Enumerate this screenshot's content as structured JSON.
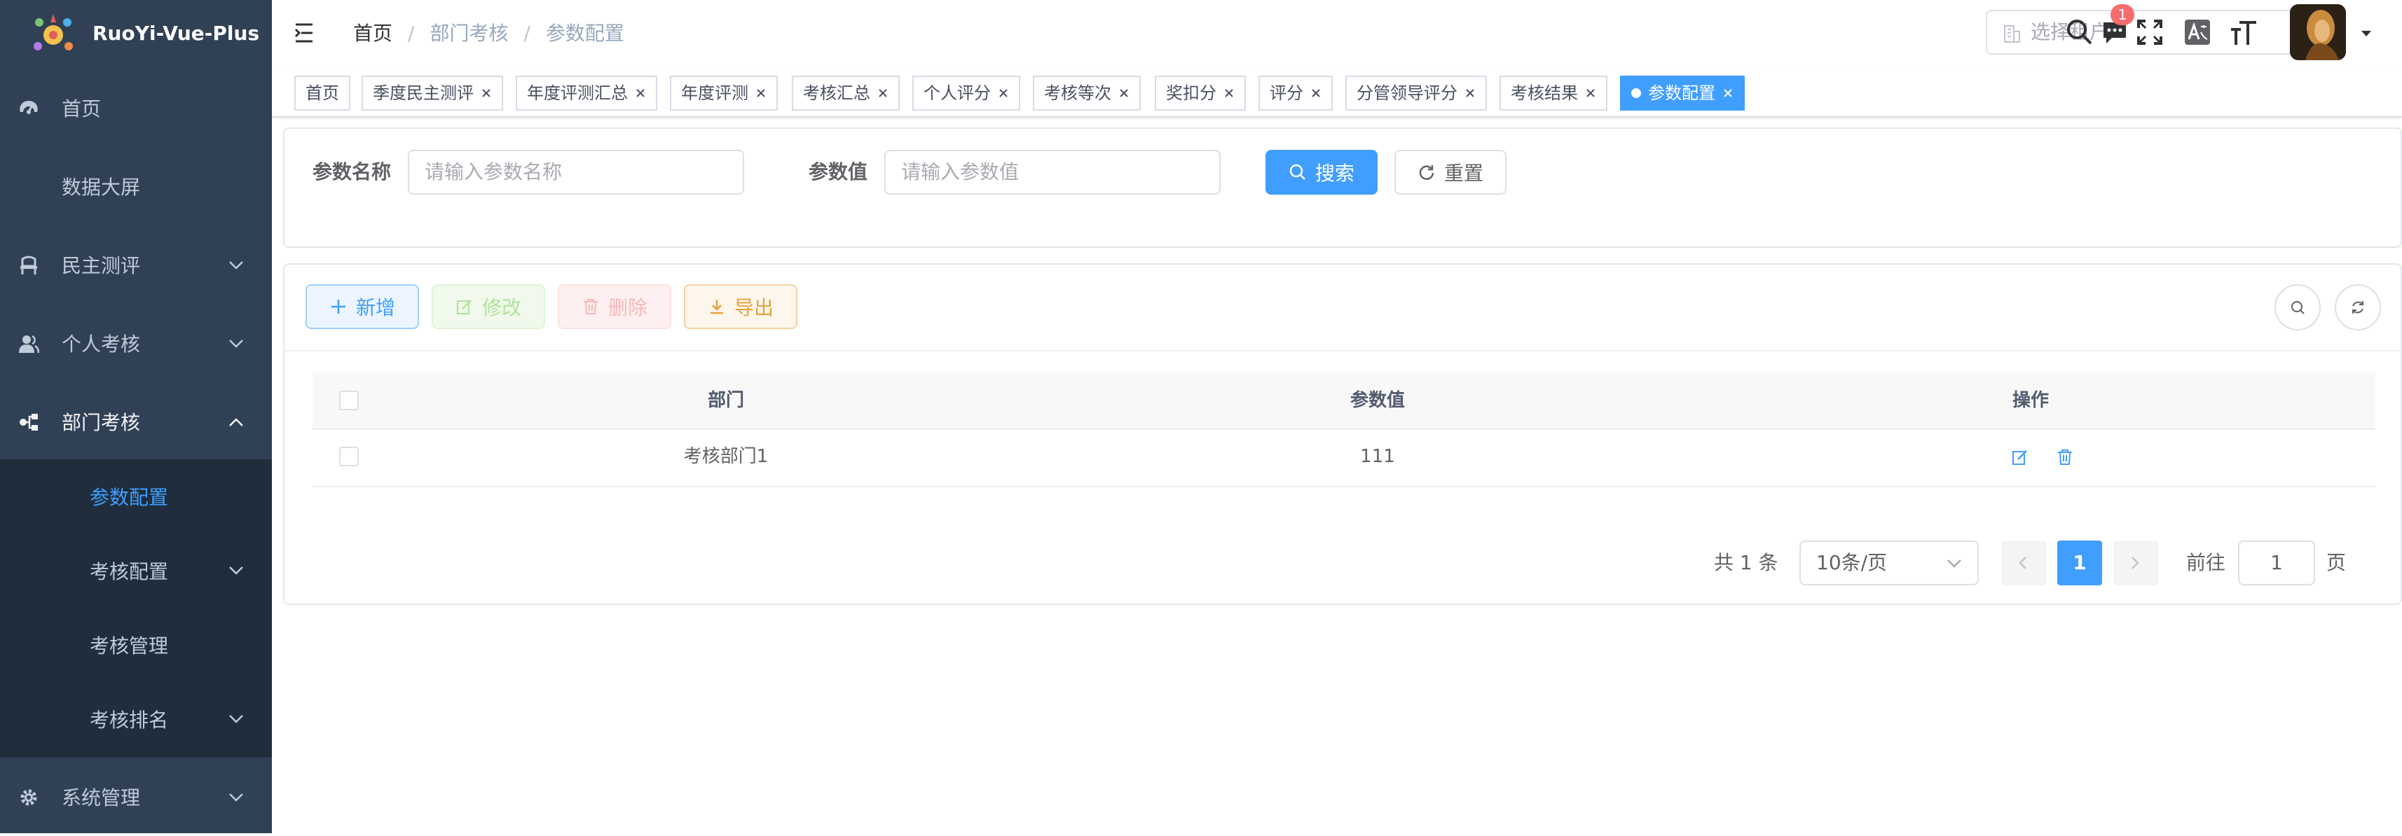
{
  "app": {
    "name": "RuoYi-Vue-Plus"
  },
  "sidebar": {
    "items": [
      {
        "label": "首页",
        "icon": "dashboard-icon"
      },
      {
        "label": "数据大屏"
      },
      {
        "label": "民主测评",
        "icon": "chair-icon",
        "expandable": true
      },
      {
        "label": "个人考核",
        "icon": "user-icon",
        "expandable": true
      },
      {
        "label": "部门考核",
        "icon": "tree-icon",
        "expandable": true,
        "expanded": true
      },
      {
        "label": "系统管理",
        "icon": "gear-icon",
        "expandable": true
      }
    ],
    "sub_items": [
      {
        "label": "参数配置",
        "active": true
      },
      {
        "label": "考核配置",
        "expandable": true
      },
      {
        "label": "考核管理"
      },
      {
        "label": "考核排名",
        "expandable": true
      }
    ]
  },
  "navbar": {
    "breadcrumb": [
      "首页",
      "部门考核",
      "参数配置"
    ],
    "tenant_placeholder": "选择租户",
    "message_count": "1"
  },
  "tags": [
    {
      "label": "首页",
      "closable": false
    },
    {
      "label": "季度民主测评",
      "closable": true
    },
    {
      "label": "年度评测汇总",
      "closable": true
    },
    {
      "label": "年度评测",
      "closable": true
    },
    {
      "label": "考核汇总",
      "closable": true
    },
    {
      "label": "个人评分",
      "closable": true
    },
    {
      "label": "考核等次",
      "closable": true
    },
    {
      "label": "奖扣分",
      "closable": true
    },
    {
      "label": "评分",
      "closable": true
    },
    {
      "label": "分管领导评分",
      "closable": true
    },
    {
      "label": "考核结果",
      "closable": true
    },
    {
      "label": "参数配置",
      "closable": true,
      "active": true
    }
  ],
  "search": {
    "param_name_label": "参数名称",
    "param_name_placeholder": "请输入参数名称",
    "param_value_label": "参数值",
    "param_value_placeholder": "请输入参数值",
    "search_button": "搜索",
    "reset_button": "重置"
  },
  "toolbar": {
    "add": "新增",
    "edit": "修改",
    "delete": "删除",
    "export": "导出"
  },
  "table": {
    "columns": [
      "部门",
      "参数值",
      "操作"
    ],
    "rows": [
      {
        "dept": "考核部门1",
        "value": "111"
      }
    ]
  },
  "pagination": {
    "total_text": "共 1 条",
    "page_size": "10条/页",
    "current_page": "1",
    "goto_label": "前往",
    "goto_value": "1",
    "page_suffix": "页"
  },
  "colors": {
    "sidebar_bg": "#304156",
    "submenu_bg": "#1f2d3d",
    "primary": "#409eff",
    "danger": "#f56c6c",
    "warning": "#e6a23c",
    "success": "#67c23a"
  }
}
